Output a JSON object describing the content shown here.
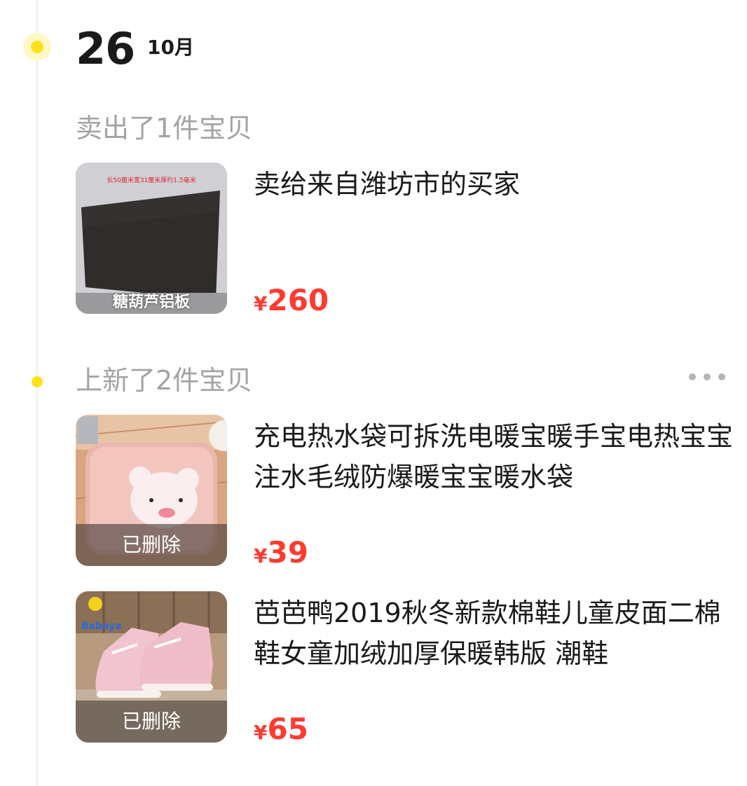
{
  "date": {
    "day": "26",
    "month": "10月"
  },
  "sections": [
    {
      "title": "卖出了1件宝贝",
      "items": [
        {
          "title": "卖给来自潍坊市的买家",
          "currency": "¥",
          "price": "260",
          "thumb_caption": "糖葫芦铝板",
          "thumb_top_text": "长50厘米宽31厘米厚约1.5毫米"
        }
      ]
    },
    {
      "title": "上新了2件宝贝",
      "more_icon": "more-dots-icon",
      "items": [
        {
          "title": "充电热水袋可拆洗电暖宝暖手宝电热宝宝注水毛绒防爆暖宝宝暖水袋",
          "currency": "¥",
          "price": "39",
          "status": "已删除"
        },
        {
          "title": "芭芭鸭2019秋冬新款棉鞋儿童皮面二棉鞋女童加绒加厚保暖韩版 潮鞋",
          "currency": "¥",
          "price": "65",
          "status": "已删除",
          "thumb_logo": "Babaya"
        }
      ]
    }
  ],
  "colors": {
    "accent_yellow": "#ffe11a",
    "price_red": "#ff3b30",
    "muted_text": "#a3a3a3",
    "timeline": "#ececec"
  }
}
